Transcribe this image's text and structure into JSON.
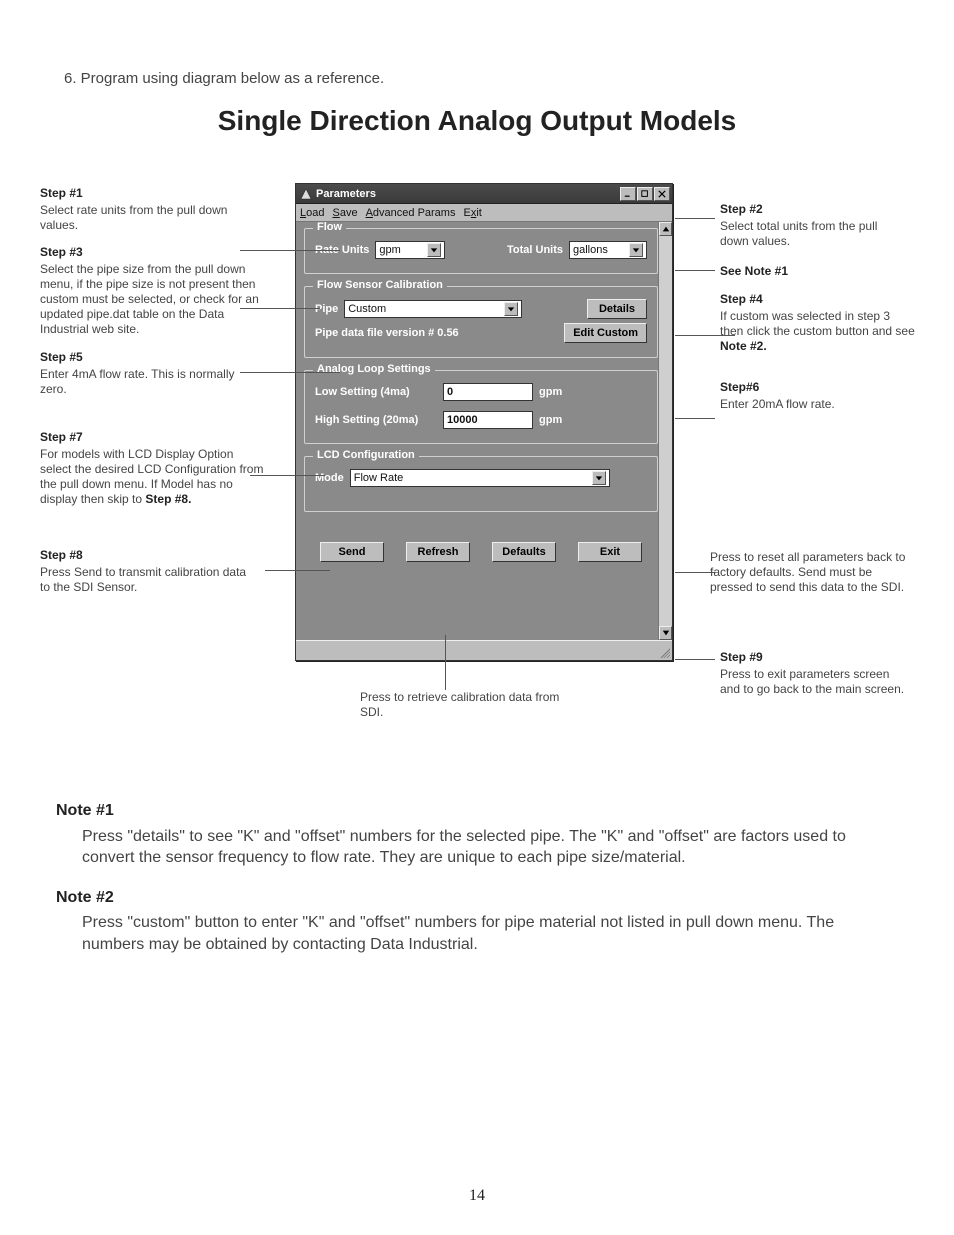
{
  "instr_line": "6.   Program using diagram below as a reference.",
  "main_title": "Single Direction Analog Output Models",
  "app": {
    "title": "Parameters",
    "menu": {
      "load": "Load",
      "save": "Save",
      "adv": "Advanced Params",
      "exit": "Exit"
    },
    "flow": {
      "legend": "Flow",
      "rate_lbl": "Rate Units",
      "rate_val": "gpm",
      "total_lbl": "Total Units",
      "total_val": "gallons"
    },
    "calib": {
      "legend": "Flow Sensor Calibration",
      "pipe_lbl": "Pipe",
      "pipe_val": "Custom",
      "details_btn": "Details",
      "version_lbl": "Pipe data file version # 0.56",
      "edit_btn": "Edit Custom"
    },
    "analog": {
      "legend": "Analog Loop Settings",
      "low_lbl": "Low Setting (4ma)",
      "low_val": "0",
      "low_unit": "gpm",
      "high_lbl": "High Setting (20ma)",
      "high_val": "10000",
      "high_unit": "gpm"
    },
    "lcd": {
      "legend": "LCD Configuration",
      "mode_lbl": "Mode",
      "mode_val": "Flow Rate"
    },
    "buttons": {
      "send": "Send",
      "refresh": "Refresh",
      "defaults": "Defaults",
      "exit": "Exit"
    }
  },
  "steps": {
    "s1": {
      "t": "Step #1",
      "b": "Select rate units from the pull down values."
    },
    "s3": {
      "t": "Step #3",
      "b": "Select the pipe size from the pull down menu, if the pipe size is not present then custom must be selected, or check for an updated pipe.dat table on the Data Industrial web site."
    },
    "s5": {
      "t": "Step #5",
      "b": "Enter 4mA flow rate. This is normally zero."
    },
    "s7a": {
      "t": "Step #7",
      "ba": "For models with LCD Display Option select the desired LCD Configuration from the pull down menu. If Model has no display then skip to ",
      "bb": "Step #8."
    },
    "s8": {
      "t": "Step #8",
      "b": "Press Send to transmit calibration data to the SDI Sensor."
    },
    "s2": {
      "t": "Step #2",
      "b": "Select total units from the pull down values."
    },
    "see1": "See Note #1",
    "s4a": {
      "t": "Step #4",
      "ba": "If custom was selected in step 3 then click the custom button and see ",
      "bb": "Note #2."
    },
    "s6": {
      "t": "Step#6",
      "b": "Enter 20mA flow rate."
    },
    "defaults_note": "Press to reset all parameters back to factory defaults. Send must be pressed to send this data to the SDI.",
    "s9": {
      "t": "Step #9",
      "b": "Press to exit parameters screen and to go back to the main screen."
    },
    "refresh_note": "Press to retrieve calibration data from SDI."
  },
  "notes": {
    "n1_head": "Note #1",
    "n1_body": "Press \"details\" to see \"K\" and \"offset\" numbers for the selected pipe. The \"K\" and \"offset\" are factors used to convert the sensor frequency to flow rate. They are unique to each pipe size/material.",
    "n2_head": "Note #2",
    "n2_body": "Press \"custom\" button to enter \"K\" and \"offset\" numbers for pipe material not listed in pull down menu. The numbers may be obtained by contacting Data Industrial."
  },
  "page_num": "14"
}
